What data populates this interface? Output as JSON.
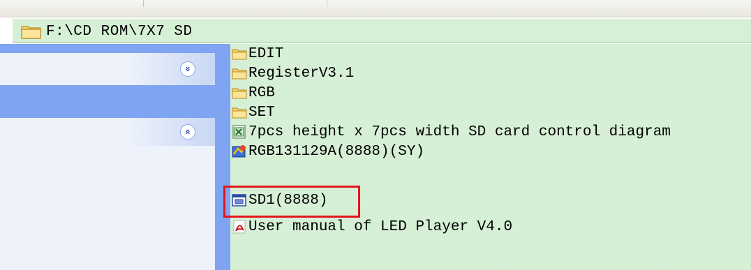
{
  "address_bar": {
    "path": "F:\\CD ROM\\7X7 SD",
    "icon": "folder-icon"
  },
  "task_pane": {
    "panels": [
      {
        "toggle_icon": "chevron-double-down-icon",
        "toggle_glyph": "»"
      },
      {
        "toggle_icon": "chevron-double-up-icon",
        "toggle_glyph": "«"
      }
    ]
  },
  "files": [
    {
      "name": "EDIT",
      "icon": "folder-icon"
    },
    {
      "name": "RegisterV3.1",
      "icon": "folder-icon"
    },
    {
      "name": "RGB",
      "icon": "folder-icon"
    },
    {
      "name": "SET",
      "icon": "folder-icon"
    },
    {
      "name": "7pcs height x 7pcs width SD card control diagram",
      "icon": "spreadsheet-icon"
    },
    {
      "name": "RGB131129A(8888)(SY)",
      "icon": "setup-icon"
    },
    {
      "name": "SD1(8888)",
      "icon": "program-window-icon",
      "highlighted": true
    },
    {
      "name": "User manual of LED Player V4.0",
      "icon": "pdf-icon"
    }
  ],
  "colors": {
    "list_background": "#d4efd4",
    "task_pane_blue": "#7fa4f2",
    "highlight_border": "#e6141c"
  }
}
